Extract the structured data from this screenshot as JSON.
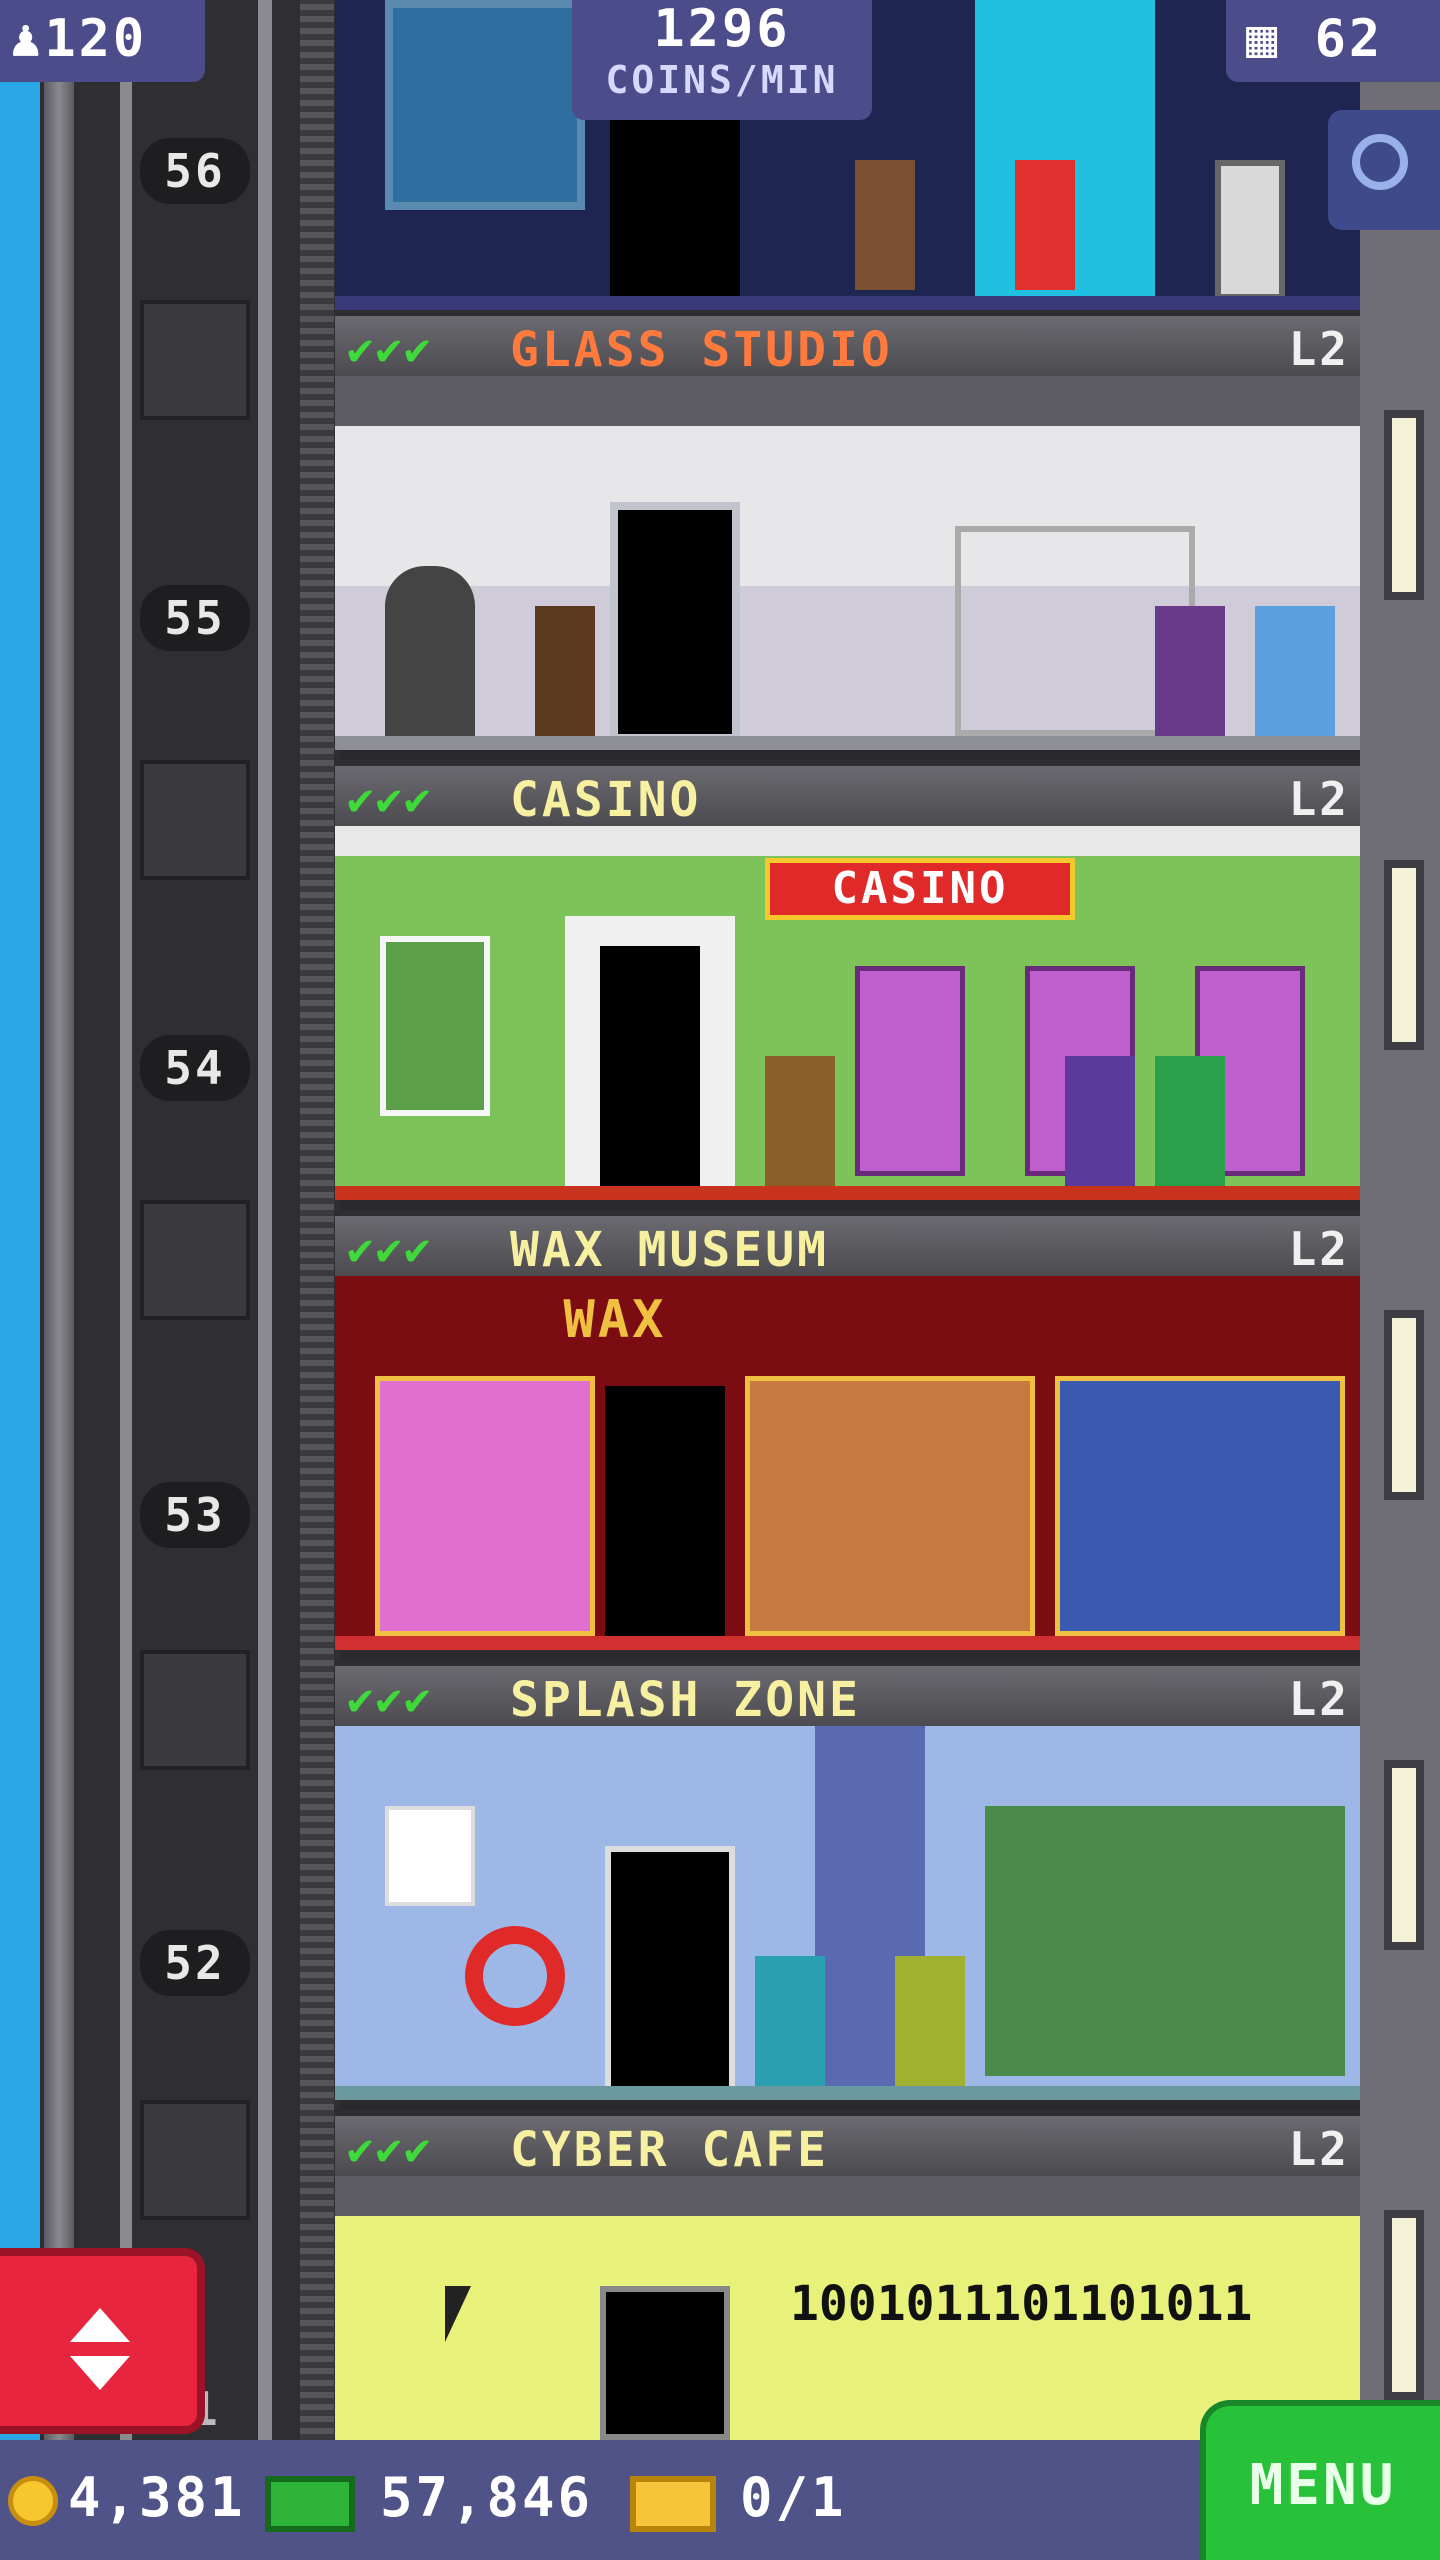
{
  "hud": {
    "population": "120",
    "coins_rate_value": "1296",
    "coins_rate_unit": "COINS/MIN",
    "floor_count": "62"
  },
  "shaft": {
    "floor_numbers": [
      "56",
      "55",
      "54",
      "53",
      "52",
      "51"
    ]
  },
  "floors": [
    {
      "name": "GLASS STUDIO",
      "level": "L2",
      "checks": "✔✔✔",
      "color": "#ff7a3c"
    },
    {
      "name": "CASINO",
      "level": "L2",
      "checks": "✔✔✔",
      "sign": "CASINO",
      "color": "#f6f0a0"
    },
    {
      "name": "WAX MUSEUM",
      "level": "L2",
      "checks": "✔✔✔",
      "sign": "WAX",
      "color": "#f6f0a0"
    },
    {
      "name": "SPLASH ZONE",
      "level": "L2",
      "checks": "✔✔✔",
      "color": "#f6f0a0"
    },
    {
      "name": "CYBER CAFE",
      "level": "L2",
      "checks": "✔✔✔",
      "binary_text": "1001011101101011",
      "color": "#f6f0a0"
    }
  ],
  "bottom_bar": {
    "coins": "4,381",
    "tower_bux": "57,846",
    "tickets": "0/1",
    "menu_label": "MENU"
  },
  "colors": {
    "hud_bg": "#4c4c8a",
    "menu_green": "#27c23a",
    "elevator_button_red": "#e8253e"
  }
}
